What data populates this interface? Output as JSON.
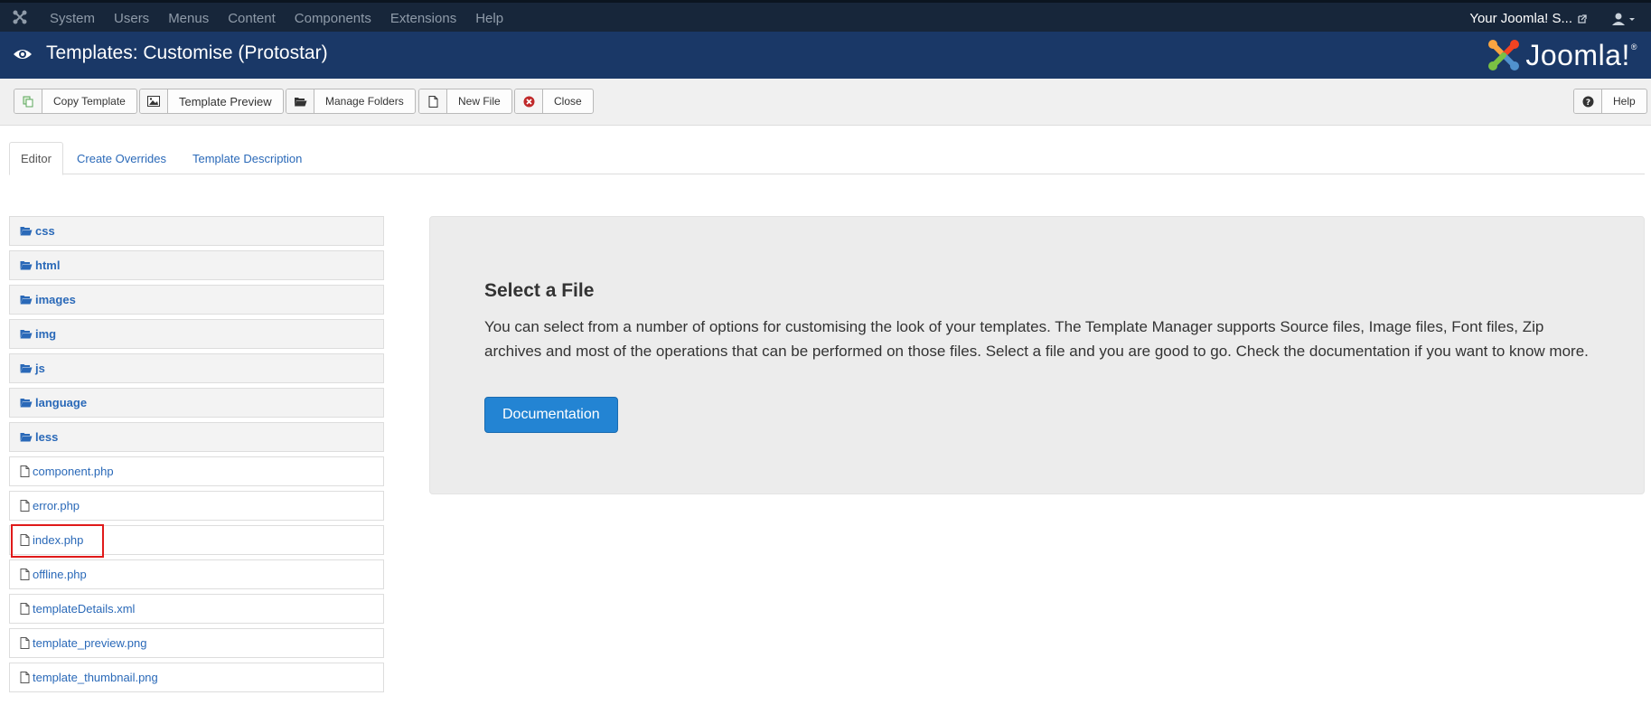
{
  "navbar": {
    "menu": [
      "System",
      "Users",
      "Menus",
      "Content",
      "Components",
      "Extensions",
      "Help"
    ],
    "site_link": "Your Joomla! S..."
  },
  "header": {
    "title": "Templates: Customise (Protostar)",
    "brand": "Joomla!"
  },
  "toolbar": {
    "copy_template": "Copy Template",
    "template_preview": "Template Preview",
    "manage_folders": "Manage Folders",
    "new_file": "New File",
    "close": "Close",
    "help": "Help"
  },
  "tabs": [
    "Editor",
    "Create Overrides",
    "Template Description"
  ],
  "tree": {
    "folders": [
      "css",
      "html",
      "images",
      "img",
      "js",
      "language",
      "less"
    ],
    "files": [
      "component.php",
      "error.php",
      "index.php",
      "offline.php",
      "templateDetails.xml",
      "template_preview.png",
      "template_thumbnail.png"
    ]
  },
  "main": {
    "heading": "Select a File",
    "body": "You can select from a number of options for customising the look of your templates. The Template Manager supports Source files, Image files, Font files, Zip archives and most of the operations that can be performed on those files. Select a file and you are good to go. Check the documentation if you want to know more.",
    "doc_button": "Documentation"
  },
  "colors": {
    "navbar": "#17263a",
    "header": "#1a3867",
    "link": "#2a69b8",
    "primary_button": "#2384d3",
    "highlight": "#e01a1a"
  },
  "icons": {
    "nav_logo": "joomla-icon",
    "eye": "eye-icon",
    "folder": "folder-open-icon",
    "file": "file-icon",
    "user": "user-icon"
  }
}
